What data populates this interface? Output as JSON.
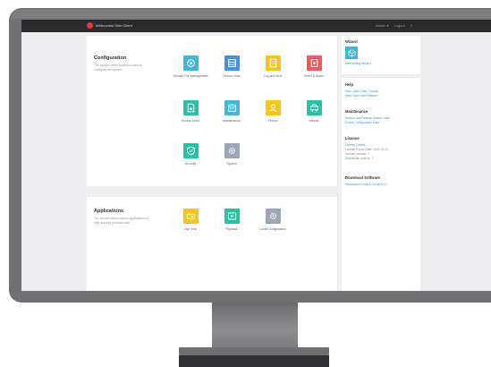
{
  "app": {
    "title": "Webcontrol Web Client",
    "top_links": [
      "Admin ▾",
      "Logout",
      "≡"
    ]
  },
  "configuration": {
    "title": "Configuration",
    "description": "The section offers functions used to configure the system.",
    "tiles": [
      {
        "label": "Remote File Management",
        "color": "#41b6d8",
        "icon": "gear-globe-icon"
      },
      {
        "label": "Record View",
        "color": "#4a90d9",
        "icon": "storage-icon"
      },
      {
        "label": "Log and Alert",
        "color": "#f5c518",
        "icon": "document-icon"
      },
      {
        "label": "Event & Alarm",
        "color": "#ef5a5a",
        "icon": "alarm-icon"
      },
      {
        "label": "Access Level",
        "color": "#25c2a4",
        "icon": "file-lock-icon"
      },
      {
        "label": "Maintenance",
        "color": "#41b6d8",
        "icon": "calendar-icon"
      },
      {
        "label": "Person",
        "color": "#f5c518",
        "icon": "person-icon"
      },
      {
        "label": "Vehicle",
        "color": "#25c2a4",
        "icon": "vehicle-icon"
      },
      {
        "label": "Security",
        "color": "#25c2a4",
        "icon": "shield-icon"
      },
      {
        "label": "System",
        "color": "#9ea7b3",
        "icon": "gear-icon"
      }
    ]
  },
  "applications": {
    "title": "Applications",
    "description": "The section offers various applications to help security professionals.",
    "tiles": [
      {
        "label": "Live View",
        "color": "#f5c518",
        "icon": "camera-icon"
      },
      {
        "label": "Playback",
        "color": "#25c2a4",
        "icon": "playback-icon"
      },
      {
        "label": "Local Configuration",
        "color": "#9ea7b3",
        "icon": "settings-icon"
      }
    ]
  },
  "sidebar": {
    "wizard": {
      "title": "Wizard",
      "link": "New setting Wizard"
    },
    "help": {
      "title": "Help",
      "links": [
        "Web Client Video Tutorial",
        "Web Client User Manual"
      ]
    },
    "maintenance": {
      "title": "Maintenance",
      "links": [
        "Backup and Restore System Data",
        "Export Configuration Data"
      ]
    },
    "license": {
      "title": "License",
      "link": "License Details",
      "lines": [
        "License Expiry Date: 2022-01-01",
        "Update License: ?",
        "Deactivate License: ?"
      ]
    },
    "download": {
      "title": "Download Software",
      "link": "Webcontrol Control Client(V1.0)"
    }
  }
}
